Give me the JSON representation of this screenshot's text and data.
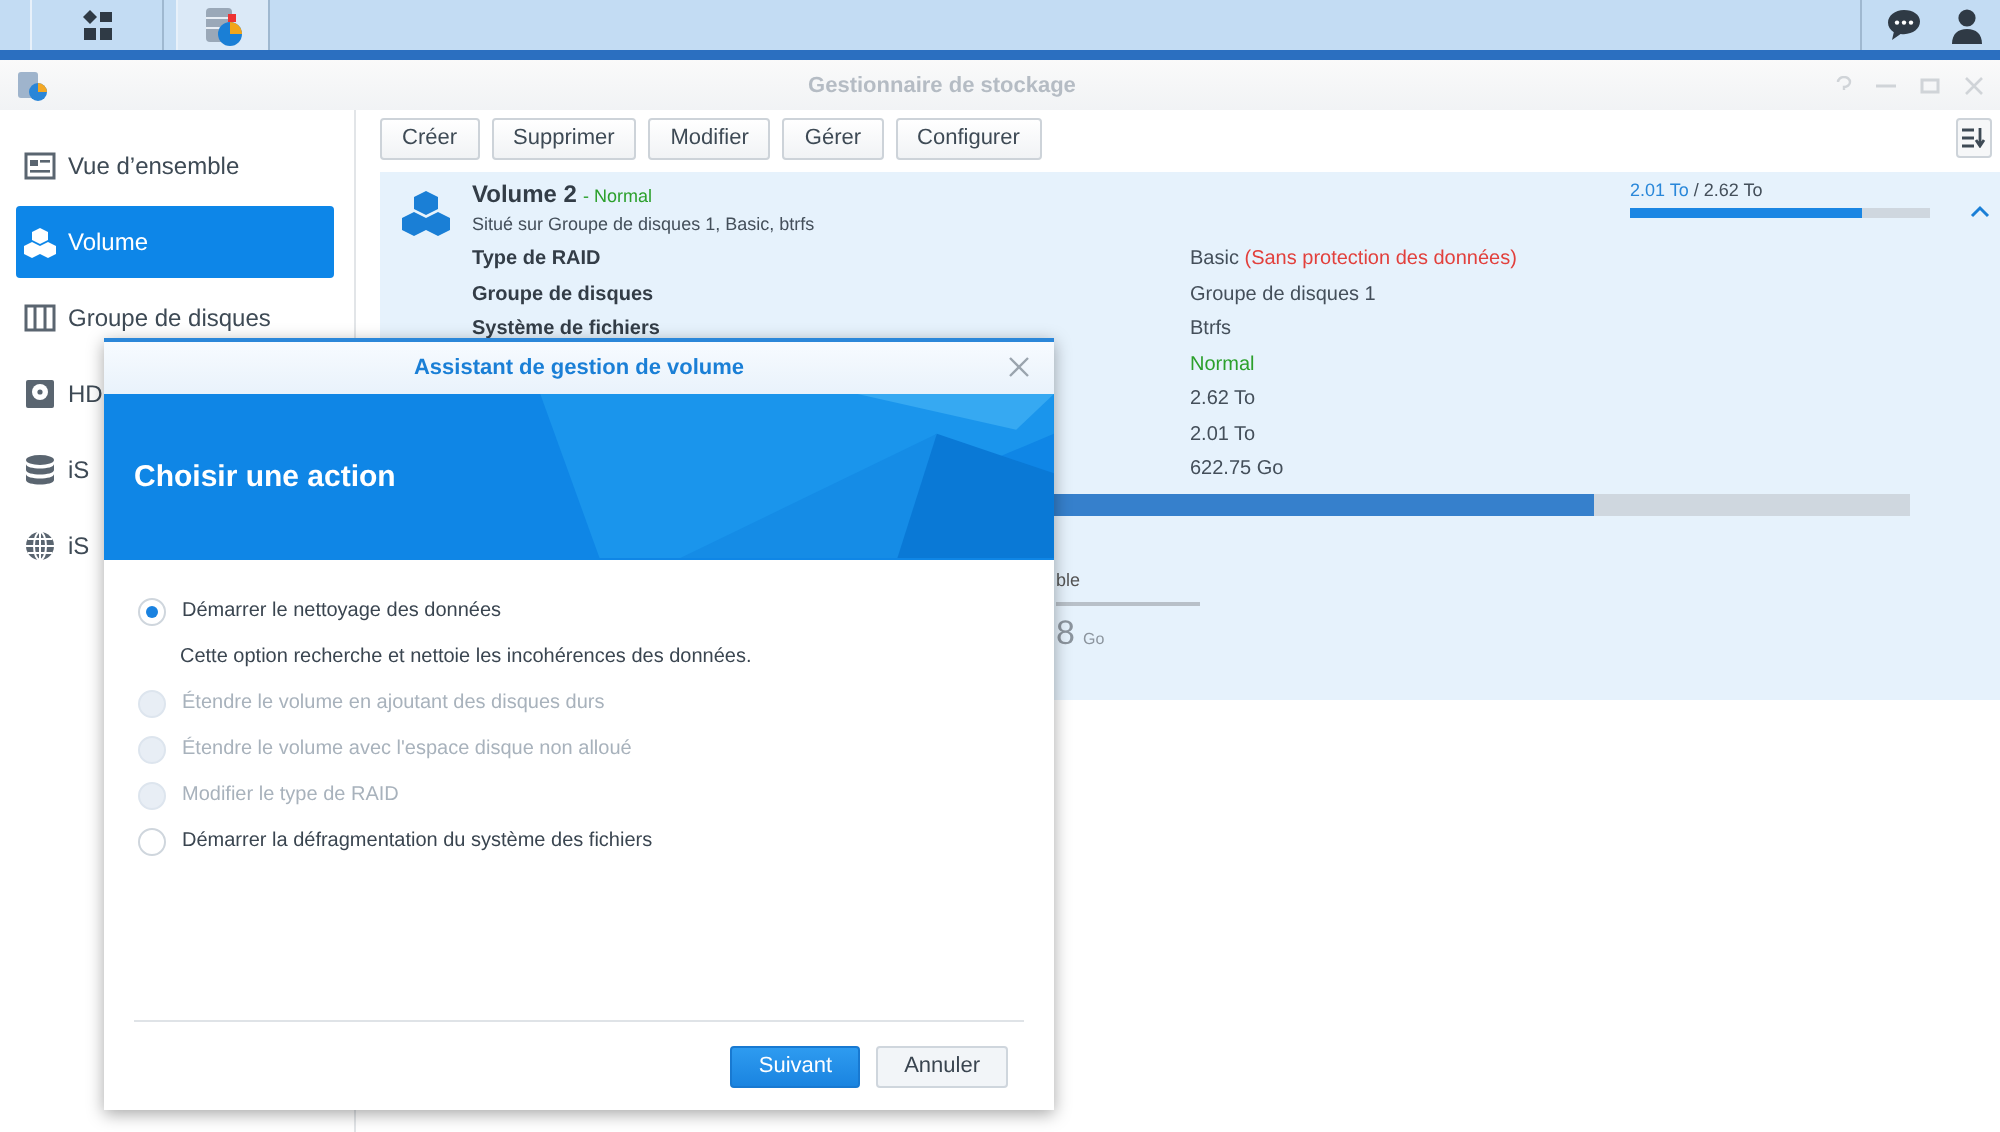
{
  "window": {
    "title": "Gestionnaire de stockage"
  },
  "sidebar": {
    "items": [
      {
        "label": "Vue d’ensemble",
        "selected": false
      },
      {
        "label": "Volume",
        "selected": true
      },
      {
        "label": "Groupe de disques",
        "selected": false
      },
      {
        "label": "HD",
        "selected": false
      },
      {
        "label": "iS",
        "selected": false
      },
      {
        "label": "iS",
        "selected": false
      }
    ]
  },
  "toolbar": {
    "buttons": [
      "Créer",
      "Supprimer",
      "Modifier",
      "Gérer",
      "Configurer"
    ]
  },
  "volume": {
    "name": "Volume 2",
    "status": "- Normal",
    "location": "Situé sur Groupe de disques 1, Basic, btrfs",
    "expanded": true,
    "usage": {
      "used": "2.01 To",
      "total": "/ 2.62 To",
      "level": 0.77
    },
    "details": [
      {
        "kind": "text",
        "label": "Type de RAID",
        "value": "Basic",
        "note": "(Sans protection des données)"
      },
      {
        "kind": "text",
        "label": "Groupe de disques",
        "value": "Groupe de disques 1"
      },
      {
        "kind": "text",
        "label": "Système de fichiers",
        "value": "Btrfs"
      },
      {
        "kind": "status",
        "value": "Normal"
      },
      {
        "kind": "text",
        "value": "2.62 To"
      },
      {
        "kind": "text",
        "value": "2.01 To"
      },
      {
        "kind": "text",
        "value": "622.75 Go"
      }
    ],
    "capacity": {
      "level": 0.78
    },
    "stat": {
      "label": "ble",
      "value": "8",
      "unit": "Go"
    }
  },
  "dialog": {
    "title": "Assistant de gestion de volume",
    "heading": "Choisir une action",
    "options": [
      {
        "label": "Démarrer le nettoyage des données",
        "selected": true,
        "disabled": false,
        "description": "Cette option recherche et nettoie les incohérences des données."
      },
      {
        "label": "Étendre le volume en ajoutant des disques durs",
        "selected": false,
        "disabled": true
      },
      {
        "label": "Étendre le volume avec l'espace disque non alloué",
        "selected": false,
        "disabled": true
      },
      {
        "label": "Modifier le type de RAID",
        "selected": false,
        "disabled": true
      },
      {
        "label": "Démarrer la défragmentation du système des fichiers",
        "selected": false,
        "disabled": false
      }
    ],
    "buttons": [
      {
        "label": "Suivant",
        "kind": "primary"
      },
      {
        "label": "Annuler",
        "kind": "secondary"
      }
    ]
  }
}
